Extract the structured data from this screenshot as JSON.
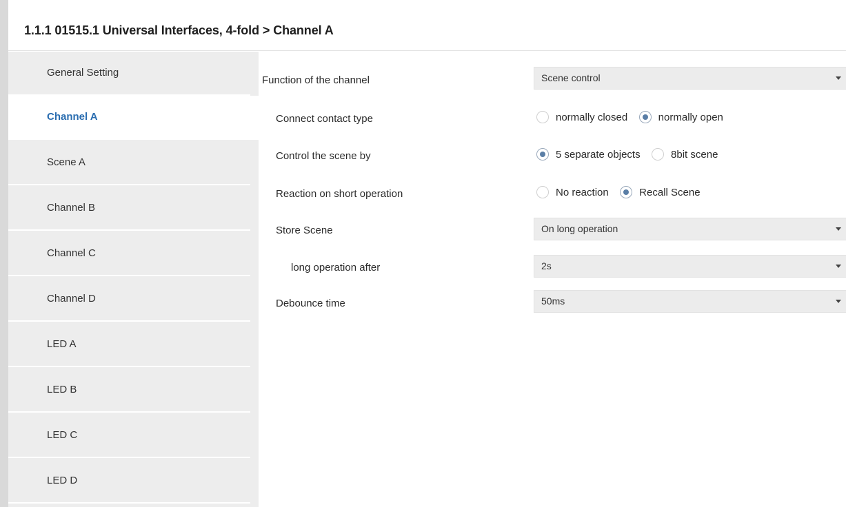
{
  "title": "1.1.1 01515.1 Universal Interfaces, 4-fold > Channel A",
  "sidebar": {
    "items": [
      {
        "label": "General Setting",
        "active": false
      },
      {
        "label": "Channel A",
        "active": true
      },
      {
        "label": "Scene A",
        "active": false
      },
      {
        "label": "Channel B",
        "active": false
      },
      {
        "label": "Channel C",
        "active": false
      },
      {
        "label": "Channel D",
        "active": false
      },
      {
        "label": "LED A",
        "active": false
      },
      {
        "label": "LED B",
        "active": false
      },
      {
        "label": "LED C",
        "active": false
      },
      {
        "label": "LED D",
        "active": false
      }
    ]
  },
  "params": {
    "function": {
      "label": "Function of the channel",
      "value": "Scene control"
    },
    "contact_type": {
      "label": "Connect contact type",
      "options": [
        "normally closed",
        "normally open"
      ],
      "selected": "normally open"
    },
    "control_scene": {
      "label": "Control the scene by",
      "options": [
        "5 separate objects",
        "8bit scene"
      ],
      "selected": "5 separate objects"
    },
    "short_operation": {
      "label": "Reaction on short operation",
      "options": [
        "No reaction",
        "Recall Scene"
      ],
      "selected": "Recall Scene"
    },
    "store_scene": {
      "label": "Store Scene",
      "value": "On long operation"
    },
    "long_operation": {
      "label": "long operation after",
      "value": "2s"
    },
    "debounce": {
      "label": "Debounce time",
      "value": "50ms"
    }
  },
  "colors": {
    "active_nav": "#2a6db0",
    "radio_dot": "#5a7ea6",
    "sidebar_bg": "#ededed",
    "select_bg": "#ececec"
  }
}
